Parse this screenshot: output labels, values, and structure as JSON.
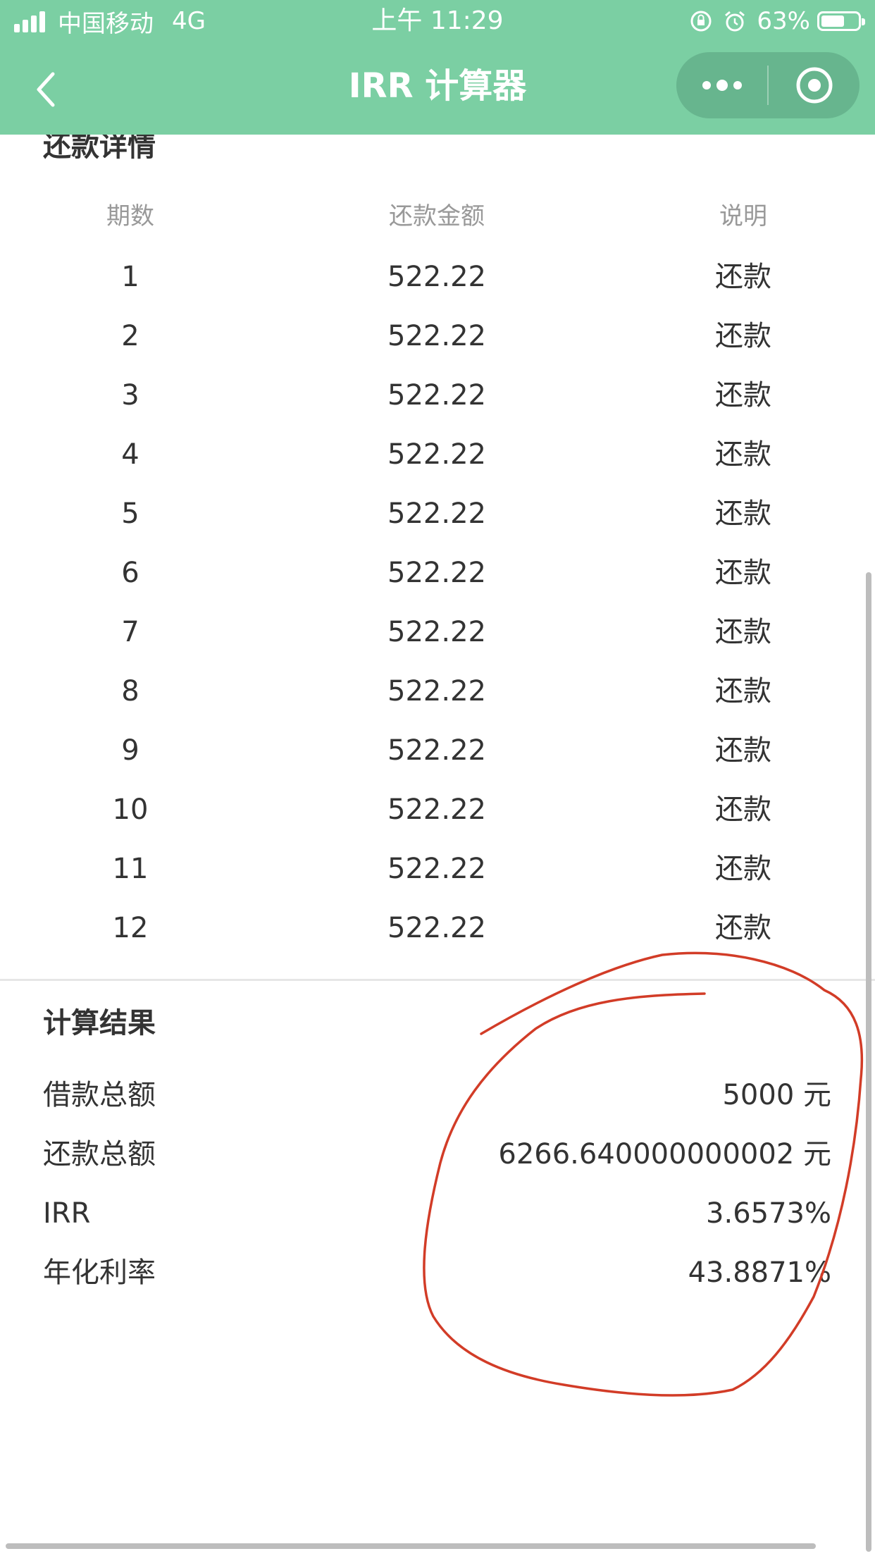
{
  "status_bar": {
    "carrier": "中国移动",
    "network": "4G",
    "time": "上午 11:29",
    "battery_percent": "63%",
    "battery_level": 0.63,
    "icons": [
      "signal-icon",
      "orientation-lock-icon",
      "alarm-icon",
      "battery-icon"
    ]
  },
  "nav": {
    "title": "IRR 计算器",
    "back_icon": "chevron-left-icon",
    "more_icon": "more-dots-icon",
    "close_icon": "target-circle-icon"
  },
  "repayment": {
    "title": "还款详情",
    "headers": [
      "期数",
      "还款金额",
      "说明"
    ],
    "rows": [
      {
        "period": "1",
        "amount": "522.22",
        "note": "还款"
      },
      {
        "period": "2",
        "amount": "522.22",
        "note": "还款"
      },
      {
        "period": "3",
        "amount": "522.22",
        "note": "还款"
      },
      {
        "period": "4",
        "amount": "522.22",
        "note": "还款"
      },
      {
        "period": "5",
        "amount": "522.22",
        "note": "还款"
      },
      {
        "period": "6",
        "amount": "522.22",
        "note": "还款"
      },
      {
        "period": "7",
        "amount": "522.22",
        "note": "还款"
      },
      {
        "period": "8",
        "amount": "522.22",
        "note": "还款"
      },
      {
        "period": "9",
        "amount": "522.22",
        "note": "还款"
      },
      {
        "period": "10",
        "amount": "522.22",
        "note": "还款"
      },
      {
        "period": "11",
        "amount": "522.22",
        "note": "还款"
      },
      {
        "period": "12",
        "amount": "522.22",
        "note": "还款"
      }
    ]
  },
  "result": {
    "title": "计算结果",
    "items": [
      {
        "label": "借款总额",
        "value": "5000 元"
      },
      {
        "label": "还款总额",
        "value": "6266.640000000002 元"
      },
      {
        "label": "IRR",
        "value": "3.6573%"
      },
      {
        "label": "年化利率",
        "value": "43.8871%"
      }
    ]
  },
  "colors": {
    "header_bg": "#7bcfa3",
    "capsule_bg": "#67b58e",
    "annotation_red": "#d23c27",
    "text_primary": "#333333",
    "text_secondary": "#999999"
  }
}
